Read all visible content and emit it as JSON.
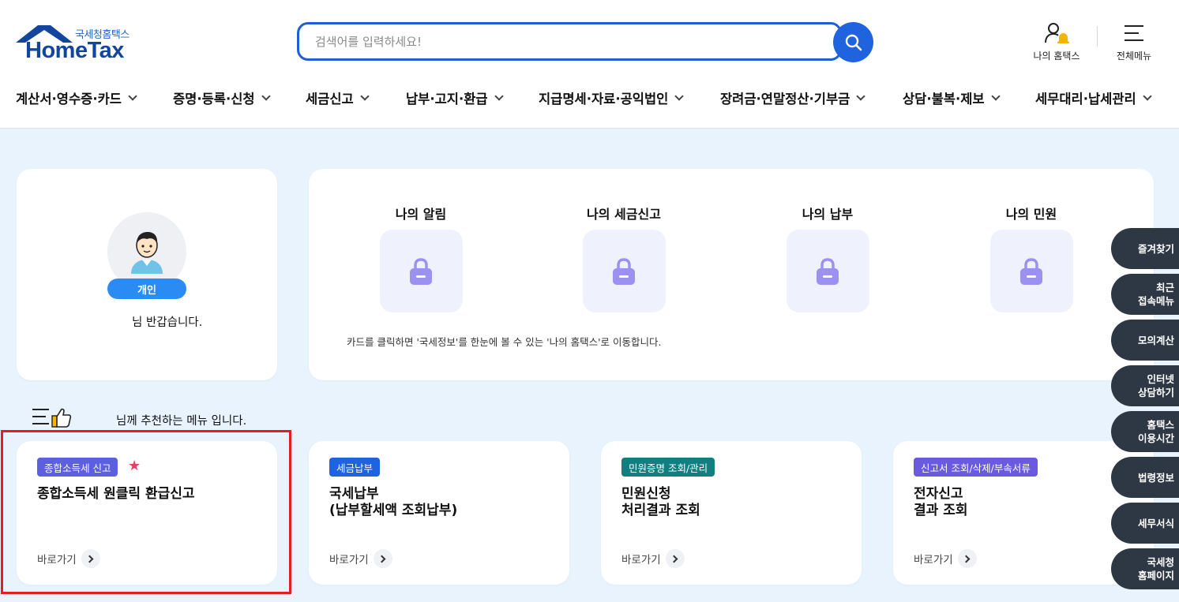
{
  "header": {
    "logo_sub": "국세청홈택스",
    "logo_main": "HomeTax",
    "search_placeholder": "검색어를 입력하세요!",
    "my_hometax_label": "나의 홈택스",
    "all_menu_label": "전체메뉴"
  },
  "gnb": [
    {
      "label": "계산서·영수증·카드"
    },
    {
      "label": "증명·등록·신청"
    },
    {
      "label": "세금신고"
    },
    {
      "label": "납부·고지·환급"
    },
    {
      "label": "지급명세·자료·공익법인"
    },
    {
      "label": "장려금·연말정산·기부금"
    },
    {
      "label": "상담·불복·제보"
    },
    {
      "label": "세무대리·납세관리"
    }
  ],
  "profile": {
    "badge": "개인",
    "greeting": "님 반갑습니다."
  },
  "my": {
    "tiles": [
      {
        "title": "나의 알림"
      },
      {
        "title": "나의 세금신고"
      },
      {
        "title": "나의 납부"
      },
      {
        "title": "나의 민원"
      }
    ],
    "note": "카드를 클릭하면 '국세정보'를 한눈에 볼 수 있는 '나의 홈택스'로 이동합니다."
  },
  "recommend": {
    "heading": "님께 추천하는 메뉴 입니다.",
    "cards": [
      {
        "tag": "종합소득세 신고",
        "tag_color": "#5b5fe0",
        "title_line1": "종합소득세 원클릭 환급신고",
        "title_line2": "",
        "go": "바로가기"
      },
      {
        "tag": "세금납부",
        "tag_color": "#1f63de",
        "title_line1": "국세납부",
        "title_line2": "(납부할세액 조회납부)",
        "go": "바로가기"
      },
      {
        "tag": "민원증명 조회/관리",
        "tag_color": "#117f80",
        "title_line1": "민원신청",
        "title_line2": "처리결과 조회",
        "go": "바로가기"
      },
      {
        "tag": "신고서 조회/삭제/부속서류",
        "tag_color": "#6a5ae0",
        "title_line1": "전자신고",
        "title_line2": "결과 조회",
        "go": "바로가기"
      }
    ]
  },
  "quick_menu": [
    {
      "label": "즐겨찾기"
    },
    {
      "label": "최근\n접속메뉴"
    },
    {
      "label": "모의계산"
    },
    {
      "label": "인터넷\n상담하기"
    },
    {
      "label": "홈택스\n이용시간"
    },
    {
      "label": "법령정보"
    },
    {
      "label": "세무서식"
    },
    {
      "label": "국세청\n홈페이지"
    }
  ]
}
